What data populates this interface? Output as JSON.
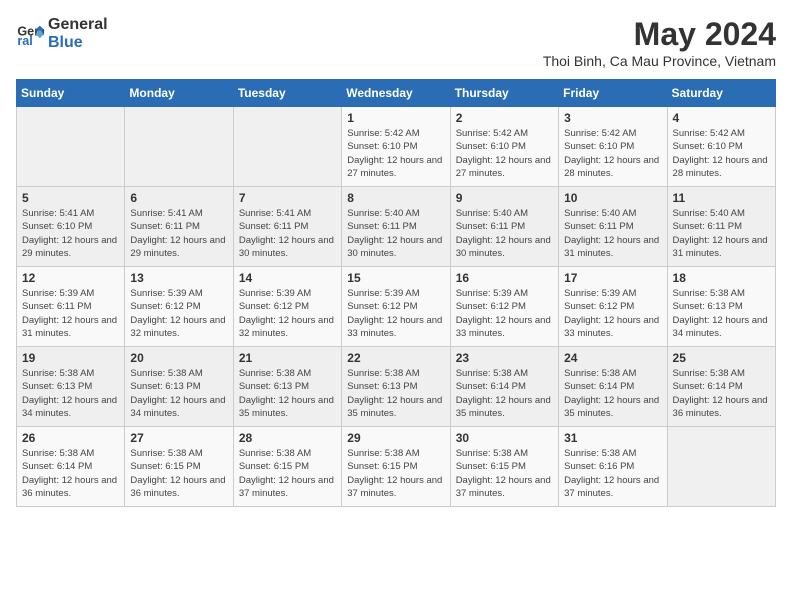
{
  "logo": {
    "line1": "General",
    "line2": "Blue"
  },
  "title": "May 2024",
  "location": "Thoi Binh, Ca Mau Province, Vietnam",
  "days_of_week": [
    "Sunday",
    "Monday",
    "Tuesday",
    "Wednesday",
    "Thursday",
    "Friday",
    "Saturday"
  ],
  "weeks": [
    [
      {
        "day": "",
        "info": ""
      },
      {
        "day": "",
        "info": ""
      },
      {
        "day": "",
        "info": ""
      },
      {
        "day": "1",
        "info": "Sunrise: 5:42 AM\nSunset: 6:10 PM\nDaylight: 12 hours\nand 27 minutes."
      },
      {
        "day": "2",
        "info": "Sunrise: 5:42 AM\nSunset: 6:10 PM\nDaylight: 12 hours\nand 27 minutes."
      },
      {
        "day": "3",
        "info": "Sunrise: 5:42 AM\nSunset: 6:10 PM\nDaylight: 12 hours\nand 28 minutes."
      },
      {
        "day": "4",
        "info": "Sunrise: 5:42 AM\nSunset: 6:10 PM\nDaylight: 12 hours\nand 28 minutes."
      }
    ],
    [
      {
        "day": "5",
        "info": "Sunrise: 5:41 AM\nSunset: 6:10 PM\nDaylight: 12 hours\nand 29 minutes."
      },
      {
        "day": "6",
        "info": "Sunrise: 5:41 AM\nSunset: 6:11 PM\nDaylight: 12 hours\nand 29 minutes."
      },
      {
        "day": "7",
        "info": "Sunrise: 5:41 AM\nSunset: 6:11 PM\nDaylight: 12 hours\nand 30 minutes."
      },
      {
        "day": "8",
        "info": "Sunrise: 5:40 AM\nSunset: 6:11 PM\nDaylight: 12 hours\nand 30 minutes."
      },
      {
        "day": "9",
        "info": "Sunrise: 5:40 AM\nSunset: 6:11 PM\nDaylight: 12 hours\nand 30 minutes."
      },
      {
        "day": "10",
        "info": "Sunrise: 5:40 AM\nSunset: 6:11 PM\nDaylight: 12 hours\nand 31 minutes."
      },
      {
        "day": "11",
        "info": "Sunrise: 5:40 AM\nSunset: 6:11 PM\nDaylight: 12 hours\nand 31 minutes."
      }
    ],
    [
      {
        "day": "12",
        "info": "Sunrise: 5:39 AM\nSunset: 6:11 PM\nDaylight: 12 hours\nand 31 minutes."
      },
      {
        "day": "13",
        "info": "Sunrise: 5:39 AM\nSunset: 6:12 PM\nDaylight: 12 hours\nand 32 minutes."
      },
      {
        "day": "14",
        "info": "Sunrise: 5:39 AM\nSunset: 6:12 PM\nDaylight: 12 hours\nand 32 minutes."
      },
      {
        "day": "15",
        "info": "Sunrise: 5:39 AM\nSunset: 6:12 PM\nDaylight: 12 hours\nand 33 minutes."
      },
      {
        "day": "16",
        "info": "Sunrise: 5:39 AM\nSunset: 6:12 PM\nDaylight: 12 hours\nand 33 minutes."
      },
      {
        "day": "17",
        "info": "Sunrise: 5:39 AM\nSunset: 6:12 PM\nDaylight: 12 hours\nand 33 minutes."
      },
      {
        "day": "18",
        "info": "Sunrise: 5:38 AM\nSunset: 6:13 PM\nDaylight: 12 hours\nand 34 minutes."
      }
    ],
    [
      {
        "day": "19",
        "info": "Sunrise: 5:38 AM\nSunset: 6:13 PM\nDaylight: 12 hours\nand 34 minutes."
      },
      {
        "day": "20",
        "info": "Sunrise: 5:38 AM\nSunset: 6:13 PM\nDaylight: 12 hours\nand 34 minutes."
      },
      {
        "day": "21",
        "info": "Sunrise: 5:38 AM\nSunset: 6:13 PM\nDaylight: 12 hours\nand 35 minutes."
      },
      {
        "day": "22",
        "info": "Sunrise: 5:38 AM\nSunset: 6:13 PM\nDaylight: 12 hours\nand 35 minutes."
      },
      {
        "day": "23",
        "info": "Sunrise: 5:38 AM\nSunset: 6:14 PM\nDaylight: 12 hours\nand 35 minutes."
      },
      {
        "day": "24",
        "info": "Sunrise: 5:38 AM\nSunset: 6:14 PM\nDaylight: 12 hours\nand 35 minutes."
      },
      {
        "day": "25",
        "info": "Sunrise: 5:38 AM\nSunset: 6:14 PM\nDaylight: 12 hours\nand 36 minutes."
      }
    ],
    [
      {
        "day": "26",
        "info": "Sunrise: 5:38 AM\nSunset: 6:14 PM\nDaylight: 12 hours\nand 36 minutes."
      },
      {
        "day": "27",
        "info": "Sunrise: 5:38 AM\nSunset: 6:15 PM\nDaylight: 12 hours\nand 36 minutes."
      },
      {
        "day": "28",
        "info": "Sunrise: 5:38 AM\nSunset: 6:15 PM\nDaylight: 12 hours\nand 37 minutes."
      },
      {
        "day": "29",
        "info": "Sunrise: 5:38 AM\nSunset: 6:15 PM\nDaylight: 12 hours\nand 37 minutes."
      },
      {
        "day": "30",
        "info": "Sunrise: 5:38 AM\nSunset: 6:15 PM\nDaylight: 12 hours\nand 37 minutes."
      },
      {
        "day": "31",
        "info": "Sunrise: 5:38 AM\nSunset: 6:16 PM\nDaylight: 12 hours\nand 37 minutes."
      },
      {
        "day": "",
        "info": ""
      }
    ]
  ]
}
